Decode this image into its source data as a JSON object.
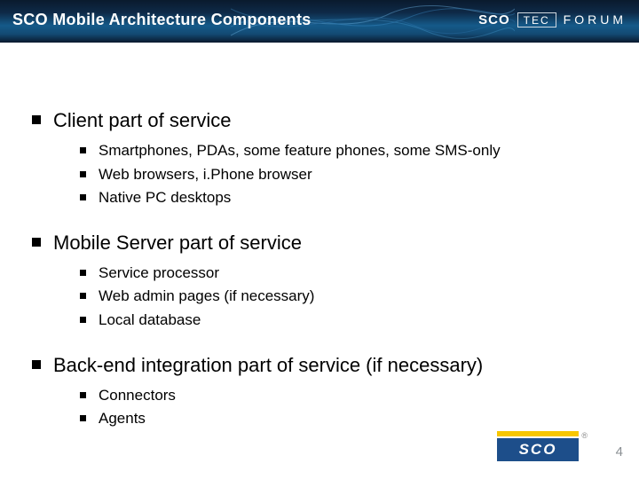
{
  "header": {
    "title": "SCO Mobile Architecture Components",
    "logo_brand": "SCO",
    "logo_tec": "TEC",
    "logo_forum": "FORUM"
  },
  "content": {
    "sections": [
      {
        "title": "Client part of service",
        "items": [
          "Smartphones, PDAs, some feature phones, some SMS-only",
          "Web browsers, i.Phone browser",
          "Native PC desktops"
        ]
      },
      {
        "title": "Mobile Server part of service",
        "items": [
          "Service processor",
          "Web admin pages (if necessary)",
          "Local database"
        ]
      },
      {
        "title": "Back-end integration part of service (if necessary)",
        "items": [
          "Connectors",
          "Agents"
        ]
      }
    ]
  },
  "footer": {
    "logo_text": "SCO",
    "registered": "®",
    "slide_number": "4"
  },
  "colors": {
    "header_dark": "#0a1a2d",
    "header_blue": "#155a89",
    "accent_yellow": "#f7c600",
    "logo_blue": "#1d4e8a",
    "page_number": "#8a8f93"
  }
}
